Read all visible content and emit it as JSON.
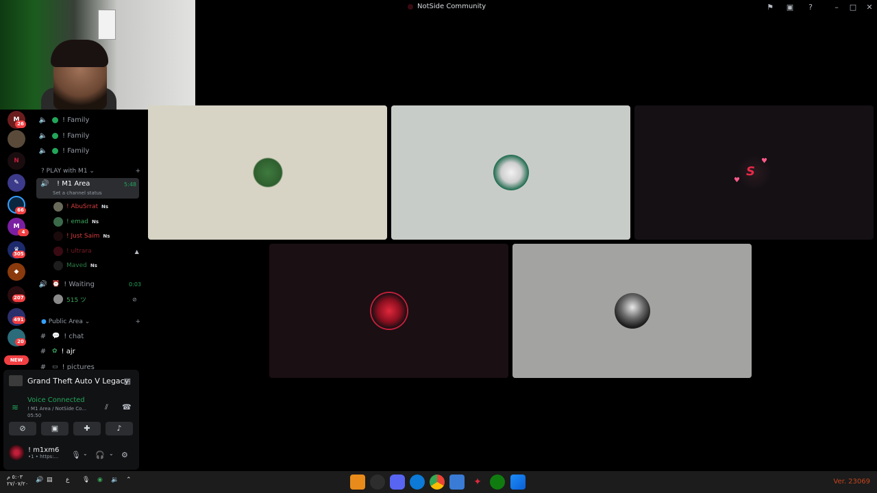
{
  "window": {
    "title": "NotSide Community",
    "colors": {
      "accent_green": "#23a55a",
      "badge_red": "#f23f43",
      "bg": "#000000"
    }
  },
  "rail": {
    "badges": [
      "26",
      "66",
      "4",
      "305",
      "207",
      "491",
      "20"
    ],
    "new_label": "NEW"
  },
  "channels": {
    "family": [
      "! Family",
      "! Family",
      "! Family"
    ],
    "category_play": "PLAY with M1",
    "active": {
      "name": "! M1 Area",
      "time": "5:48",
      "status": "Set a channel status"
    },
    "users": [
      {
        "name": "! AbuSrrat",
        "tag": "Ns",
        "color": "#d83c3e"
      },
      {
        "name": "! emad",
        "tag": "Ns",
        "color": "#3ba55c"
      },
      {
        "name": "! Just Saim",
        "tag": "Ns",
        "color": "#d83c3e"
      },
      {
        "name": "! ultrara",
        "tag": "",
        "color": "#7a1b24"
      },
      {
        "name": "Maved",
        "tag": "Ns",
        "color": "#2d7d46"
      }
    ],
    "waiting": {
      "name": "! Waiting",
      "time": "0:03"
    },
    "waiting_user": "515 ツ",
    "category_public": "Public Area",
    "text": [
      "! chat",
      "! ajr",
      "! pictures"
    ]
  },
  "panel": {
    "game": "Grand Theft Auto V Legacy",
    "voice_status": "Voice Connected",
    "voice_channel": "! M1 Area / NotSide Co...",
    "voice_time": "05:50",
    "username": "! m1xm6",
    "user_sub": "•1 • https:..."
  },
  "taskbar": {
    "clock_top": "٥:٠٣ م",
    "clock_bottom": "٢٧/٠٧/٢٠",
    "lang": "ع",
    "version": "Ver. 23069"
  }
}
